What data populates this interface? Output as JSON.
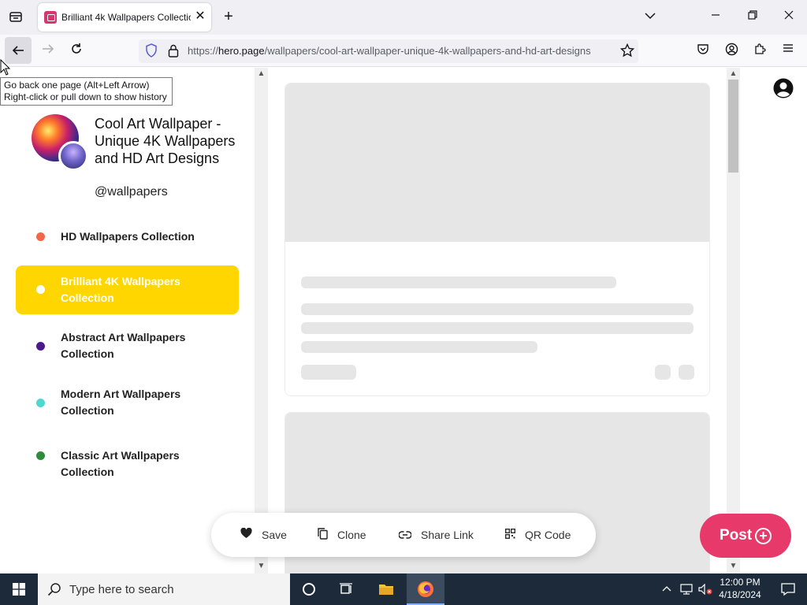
{
  "browser": {
    "tab_title": "Brilliant 4k Wallpapers Collection",
    "url_host": "hero.page",
    "url_prefix": "https://",
    "url_path": "/wallpapers/cool-art-wallpaper-unique-4k-wallpapers-and-hd-art-designs",
    "tooltip_line1": "Go back one page (Alt+Left Arrow)",
    "tooltip_line2": "Right-click or pull down to show history"
  },
  "profile": {
    "title": "Cool Art Wallpaper - Unique 4K Wallpapers and HD Art Designs",
    "handle": "@wallpapers"
  },
  "categories": [
    {
      "label": "HD Wallpapers Collection",
      "color": "#f2674a",
      "active": false
    },
    {
      "label": "Brilliant 4K Wallpapers Collection",
      "color": "#ffffff",
      "active": true
    },
    {
      "label": "Abstract Art Wallpapers Collection",
      "color": "#4a1a8c",
      "active": false
    },
    {
      "label": "Modern Art Wallpapers Collection",
      "color": "#4fd6d0",
      "active": false
    },
    {
      "label": "Classic Art Wallpapers Collection",
      "color": "#2e8b3a",
      "active": false
    }
  ],
  "actions": {
    "save": "Save",
    "clone": "Clone",
    "share": "Share Link",
    "qr": "QR Code"
  },
  "post_button": "Post",
  "taskbar": {
    "search_placeholder": "Type here to search",
    "time": "12:00 PM",
    "date": "4/18/2024"
  },
  "colors": {
    "accent_yellow": "#ffd600",
    "post_pink": "#e8396b"
  }
}
